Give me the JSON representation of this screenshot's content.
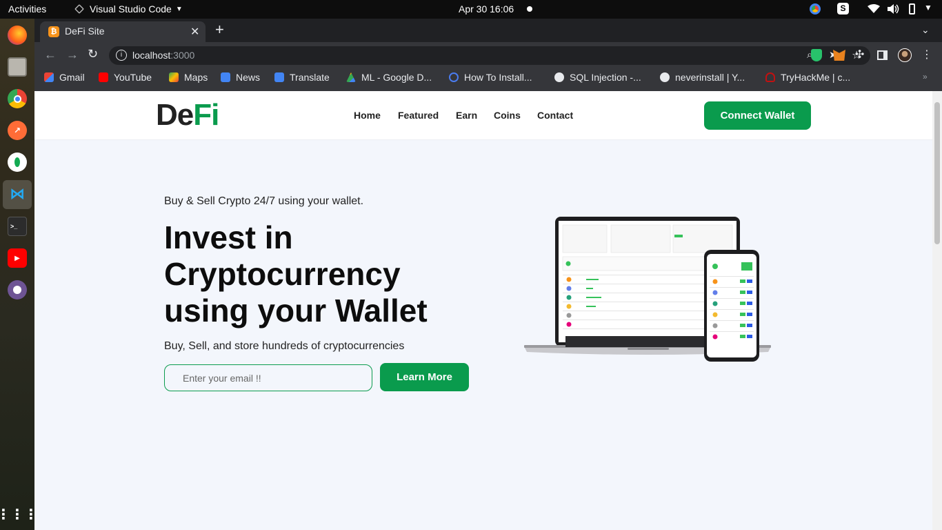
{
  "topbar": {
    "activities": "Activities",
    "app_name": "Visual Studio Code",
    "clock": "Apr 30  16:06"
  },
  "browser": {
    "tab_title": "DeFi Site",
    "url_host": "localhost",
    "url_port": ":3000",
    "bookmarks": [
      "Gmail",
      "YouTube",
      "Maps",
      "News",
      "Translate",
      "ML - Google D...",
      "How To Install...",
      "SQL Injection -...",
      "neverinstall | Y...",
      "TryHackMe | c..."
    ]
  },
  "site": {
    "logo_part1": "De",
    "logo_part2": "Fi",
    "nav": [
      "Home",
      "Featured",
      "Earn",
      "Coins",
      "Contact"
    ],
    "connect_label": "Connect Wallet",
    "tagline": "Buy & Sell Crypto 24/7 using your wallet.",
    "title_line1": "Invest in",
    "title_line2": "Cryptocurrency",
    "title_line3": "using your Wallet",
    "subtitle": "Buy, Sell, and store hundreds of cryptocurrencies",
    "email_placeholder": "Enter your email !!",
    "learn_label": "Learn More"
  },
  "colors": {
    "brand_green": "#0a9b4d",
    "page_bg": "#f3f6fc",
    "chrome_dark": "#35363a"
  }
}
